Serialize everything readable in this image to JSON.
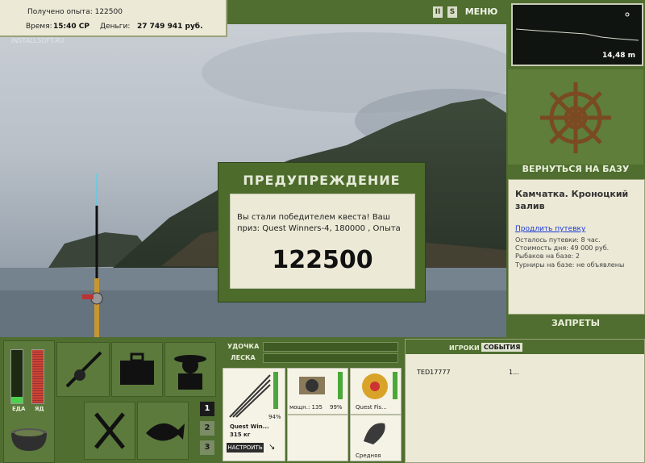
{
  "info": {
    "exp_label": "Получено опыта: 122500",
    "time_label": "Время:",
    "time_value": "15:40 СР",
    "money_label": "Деньги:",
    "money_value": "27 749 941 руб."
  },
  "watermark": "INSTALLSOFT.RU",
  "top_buttons": {
    "pause": "II",
    "sound": "S",
    "menu": "МЕНЮ"
  },
  "depth": {
    "value": "14,48 m"
  },
  "right_panel": {
    "back_to_base": "ВЕРНУТЬСЯ НА БАЗУ",
    "location": "Камчатка. Кроноцкий залив",
    "extend_link": "Продлить путевку",
    "remaining": "Осталось путевки: 8 час.",
    "day_cost": "Стоимость дня: 49 000 руб.",
    "fishers": "Рыбаков на базе: 2",
    "tournaments": "Турниры на базе: не объявлены",
    "bans": "ЗАПРЕТЫ"
  },
  "dialog": {
    "title": "ПРЕДУПРЕЖДЕНИЕ",
    "message": "Вы стали победителем квеста! Ваш приз: Quest Winners-4, 180000 , Опыта",
    "amount": "122500"
  },
  "meters": {
    "food": "ЕДА",
    "poison": "ЯД"
  },
  "page_buttons": [
    "1",
    "2",
    "3"
  ],
  "gear": {
    "rod_label": "УДОЧКА",
    "line_label": "ЛЕСКА",
    "rod_name": "Quest Win...",
    "rod_weight": "315 кг",
    "rod_pct": "94%",
    "reel_power": "мощн.: 135",
    "reel_pct": "99%",
    "line_name": "Quest Fis...",
    "lure_size": "Средняя",
    "setup_button": "НАСТРОИТЬ"
  },
  "players": {
    "tab_players": "ИГРОКИ",
    "tab_events": "СОБЫТИЯ",
    "rows": [
      {
        "name": "TED17777",
        "value": "1..."
      }
    ]
  }
}
